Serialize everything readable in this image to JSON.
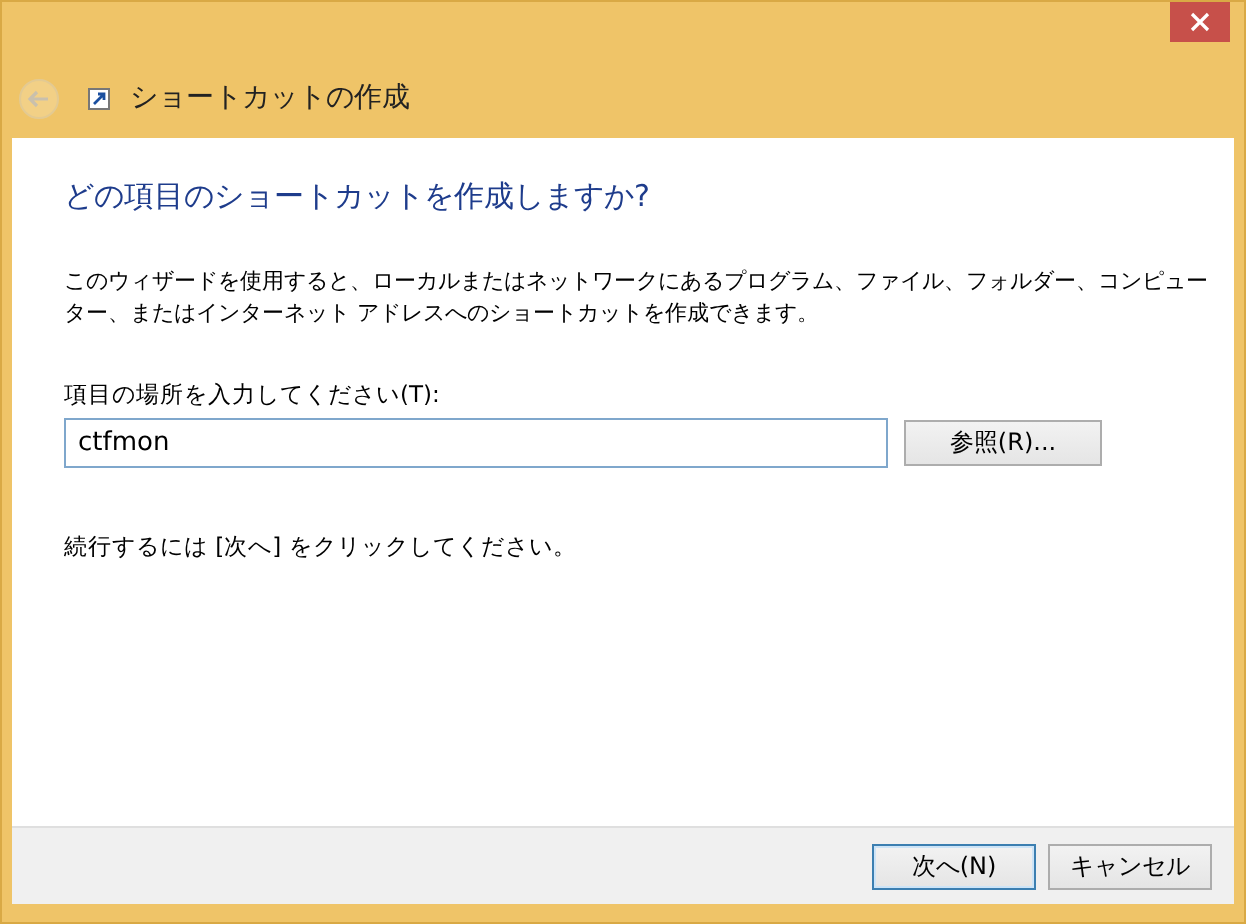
{
  "window": {
    "title": "ショートカットの作成",
    "back_disabled": true
  },
  "heading": "どの項目のショートカットを作成しますか?",
  "description": "このウィザードを使用すると、ローカルまたはネットワークにあるプログラム、ファイル、フォルダー、コンピューター、またはインターネット アドレスへのショートカットを作成できます。",
  "location": {
    "label": "項目の場所を入力してください(T):",
    "value": "ctfmon",
    "browse": "参照(R)..."
  },
  "hint": "続行するには [次へ] をクリックしてください。",
  "buttons": [
    {
      "label": "次へ(N)",
      "default": true
    },
    {
      "label": "キャンセル",
      "default": false
    }
  ]
}
